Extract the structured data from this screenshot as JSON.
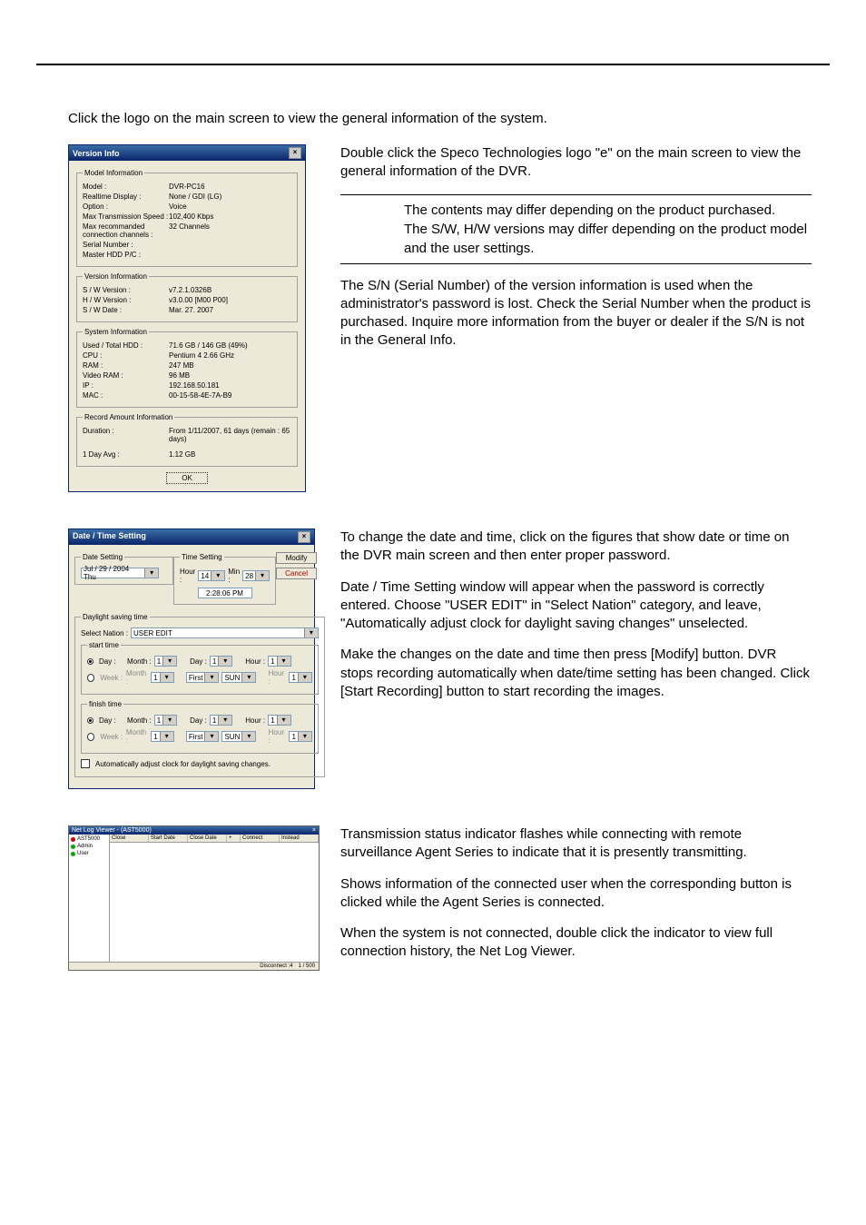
{
  "intro": "Click the logo on the main screen to view the general information of the system.",
  "versionDlg": {
    "title": "Version Info",
    "groups": {
      "model": {
        "legend": "Model Information",
        "rows": [
          {
            "k": "Model :",
            "v": "DVR-PC16"
          },
          {
            "k": "Realtime Display :",
            "v": "None / GDI (LG)"
          },
          {
            "k": "Option :",
            "v": "Voice"
          },
          {
            "k": "Max Transmission Speed :",
            "v": "102,400 Kbps"
          },
          {
            "k": "Max recommanded connection channels :",
            "v": "32 Channels"
          },
          {
            "k": "Serial Number :",
            "v": ""
          },
          {
            "k": "Master HDD P/C :",
            "v": ""
          }
        ]
      },
      "version": {
        "legend": "Version Information",
        "rows": [
          {
            "k": "S / W Version :",
            "v": "v7.2.1.0326B"
          },
          {
            "k": "H / W Version :",
            "v": "v3.0.00 [M00 P00]"
          },
          {
            "k": "S / W Date :",
            "v": "Mar. 27. 2007"
          }
        ]
      },
      "system": {
        "legend": "System Information",
        "rows": [
          {
            "k": "Used / Total HDD :",
            "v": "71.6 GB / 146 GB (49%)"
          },
          {
            "k": "CPU :",
            "v": "Pentium 4  2.66 GHz"
          },
          {
            "k": "RAM :",
            "v": "247 MB"
          },
          {
            "k": "Video RAM :",
            "v": "96 MB"
          },
          {
            "k": "IP :",
            "v": "192.168.50.181"
          },
          {
            "k": "MAC :",
            "v": "00-15-58-4E-7A-B9"
          }
        ]
      },
      "record": {
        "legend": "Record Amount Information",
        "rows": [
          {
            "k": "Duration :",
            "v": "From 1/11/2007, 61 days (remain : 65 days)"
          },
          {
            "k": "1 Day Avg :",
            "v": "1.12 GB"
          }
        ]
      }
    },
    "ok": "OK"
  },
  "versionText": {
    "p1": "Double click the Speco Technologies logo \"e\" on the main screen to view the general information of the DVR.",
    "note1": "The contents may differ depending on the product purchased.",
    "note2": "The S/W, H/W versions may differ depending on the product model and the user settings.",
    "p2": "The S/N (Serial Number) of the version information is used when the administrator's password is lost. Check the Serial Number when the product is purchased. Inquire more information from the buyer or dealer if the S/N is not in the General Info."
  },
  "dtDlg": {
    "title": "Date / Time Setting",
    "dateLegend": "Date Setting",
    "dateValue": "Jul  / 29 / 2004   Thu",
    "timeLegend": "Time Setting",
    "hourLabel": "Hour :",
    "hourVal": "14",
    "minLabel": "Min :",
    "minVal": "28",
    "clock": "2:28:06 PM",
    "modify": "Modify",
    "cancel": "Cancel",
    "dstLegend": "Daylight saving time",
    "selectNationLabel": "Select Nation :",
    "selectNationVal": "USER EDIT",
    "startLegend": "start time",
    "finishLegend": "finish time",
    "dayLabel": "Day :",
    "weekLabel": "Week :",
    "monthLabel": "Month :",
    "dLabel": "Day :",
    "firstLabel": "First",
    "sunLabel": "SUN",
    "hLabel": "Hour :",
    "one": "1",
    "autoLabel": "Automatically adjust clock for daylight saving changes."
  },
  "dtText": {
    "p1": "To change the date and time, click on the figures that show date or time on the DVR main screen and then enter proper password.",
    "p2": "Date / Time Setting window will appear when the password is correctly entered. Choose \"USER EDIT\" in \"Select Nation\" category, and leave, \"Automatically adjust clock for daylight saving changes\" unselected.",
    "p3": "Make the changes on the date and time then press [Modify] button. DVR stops recording automatically when date/time setting has been changed. Click [Start Recording] button to start recording the images."
  },
  "netDlg": {
    "title": "Net Log Viewer - (AST5000)",
    "sideItems": [
      {
        "color": "red",
        "label": "AST5000"
      },
      {
        "color": "green",
        "label": "Admin"
      },
      {
        "color": "green",
        "label": "User"
      }
    ],
    "cols": [
      "Close",
      "Start Date",
      "Close Date",
      "+",
      "Connect",
      "Instead"
    ],
    "statusItems": [
      "Disconnect :4",
      "1 / 500"
    ]
  },
  "netText": {
    "p1": "Transmission status indicator flashes while connecting with remote surveillance Agent Series to indicate that it is presently transmitting.",
    "p2": "Shows information of the connected user when the corresponding button is clicked while the Agent Series is connected.",
    "p3": "When the system is not connected, double click the indicator to view full connection history, the Net Log Viewer."
  }
}
